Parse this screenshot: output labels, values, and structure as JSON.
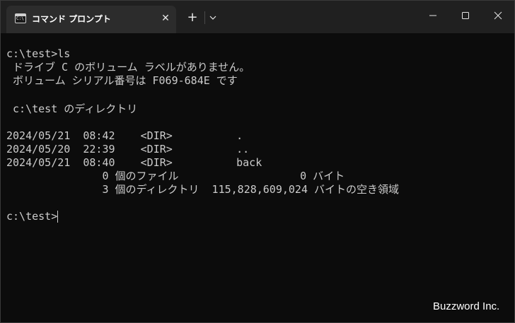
{
  "window": {
    "tab_title": "コマンド プロンプト",
    "icons": {
      "tab": "command-prompt-icon",
      "close_tab": "close-icon",
      "new_tab": "plus-icon",
      "dropdown": "chevron-down-icon",
      "minimize": "minimize-icon",
      "maximize": "maximize-icon",
      "close_window": "close-icon"
    },
    "colors": {
      "titlebar": "#202020",
      "tab": "#2c2c2c",
      "terminal_bg": "#0c0c0c",
      "terminal_text": "#cccccc"
    }
  },
  "terminal": {
    "lines": [
      "c:\\test>ls",
      " ドライブ C のボリューム ラベルがありません。",
      " ボリューム シリアル番号は F069-684E です",
      "",
      " c:\\test のディレクトリ",
      "",
      "2024/05/21  08:42    <DIR>          .",
      "2024/05/20  22:39    <DIR>          ..",
      "2024/05/21  08:40    <DIR>          back",
      "               0 個のファイル                   0 バイト",
      "               3 個のディレクトリ  115,828,609,024 バイトの空き領域",
      "",
      "c:\\test>"
    ]
  },
  "watermark": "Buzzword Inc."
}
